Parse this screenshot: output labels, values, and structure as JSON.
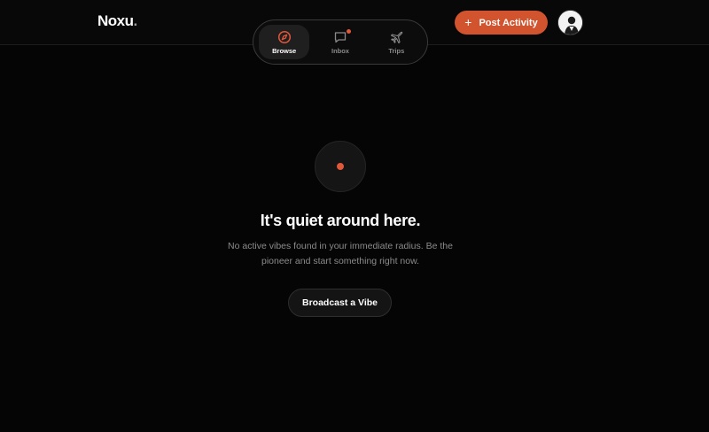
{
  "app": {
    "logo_text": "Noxu",
    "logo_dot": "."
  },
  "nav": {
    "items": [
      {
        "label": "Browse",
        "icon": "compass-icon",
        "active": true
      },
      {
        "label": "Inbox",
        "icon": "chat-bubble-icon",
        "active": false,
        "has_notification": true
      },
      {
        "label": "Trips",
        "icon": "plane-icon",
        "active": false
      }
    ]
  },
  "header": {
    "post_button_label": "Post Activity",
    "post_button_icon": "plus-icon",
    "avatar_icon": "user-avatar"
  },
  "empty_state": {
    "icon": "pulse-dot-icon",
    "title": "It's quiet around here.",
    "message": "No active vibes found in your immediate radius. Be the pioneer and start something right now.",
    "cta_label": "Broadcast a Vibe"
  },
  "colors": {
    "accent": "#d2542f",
    "background": "#050505",
    "notification": "#e0573a"
  }
}
